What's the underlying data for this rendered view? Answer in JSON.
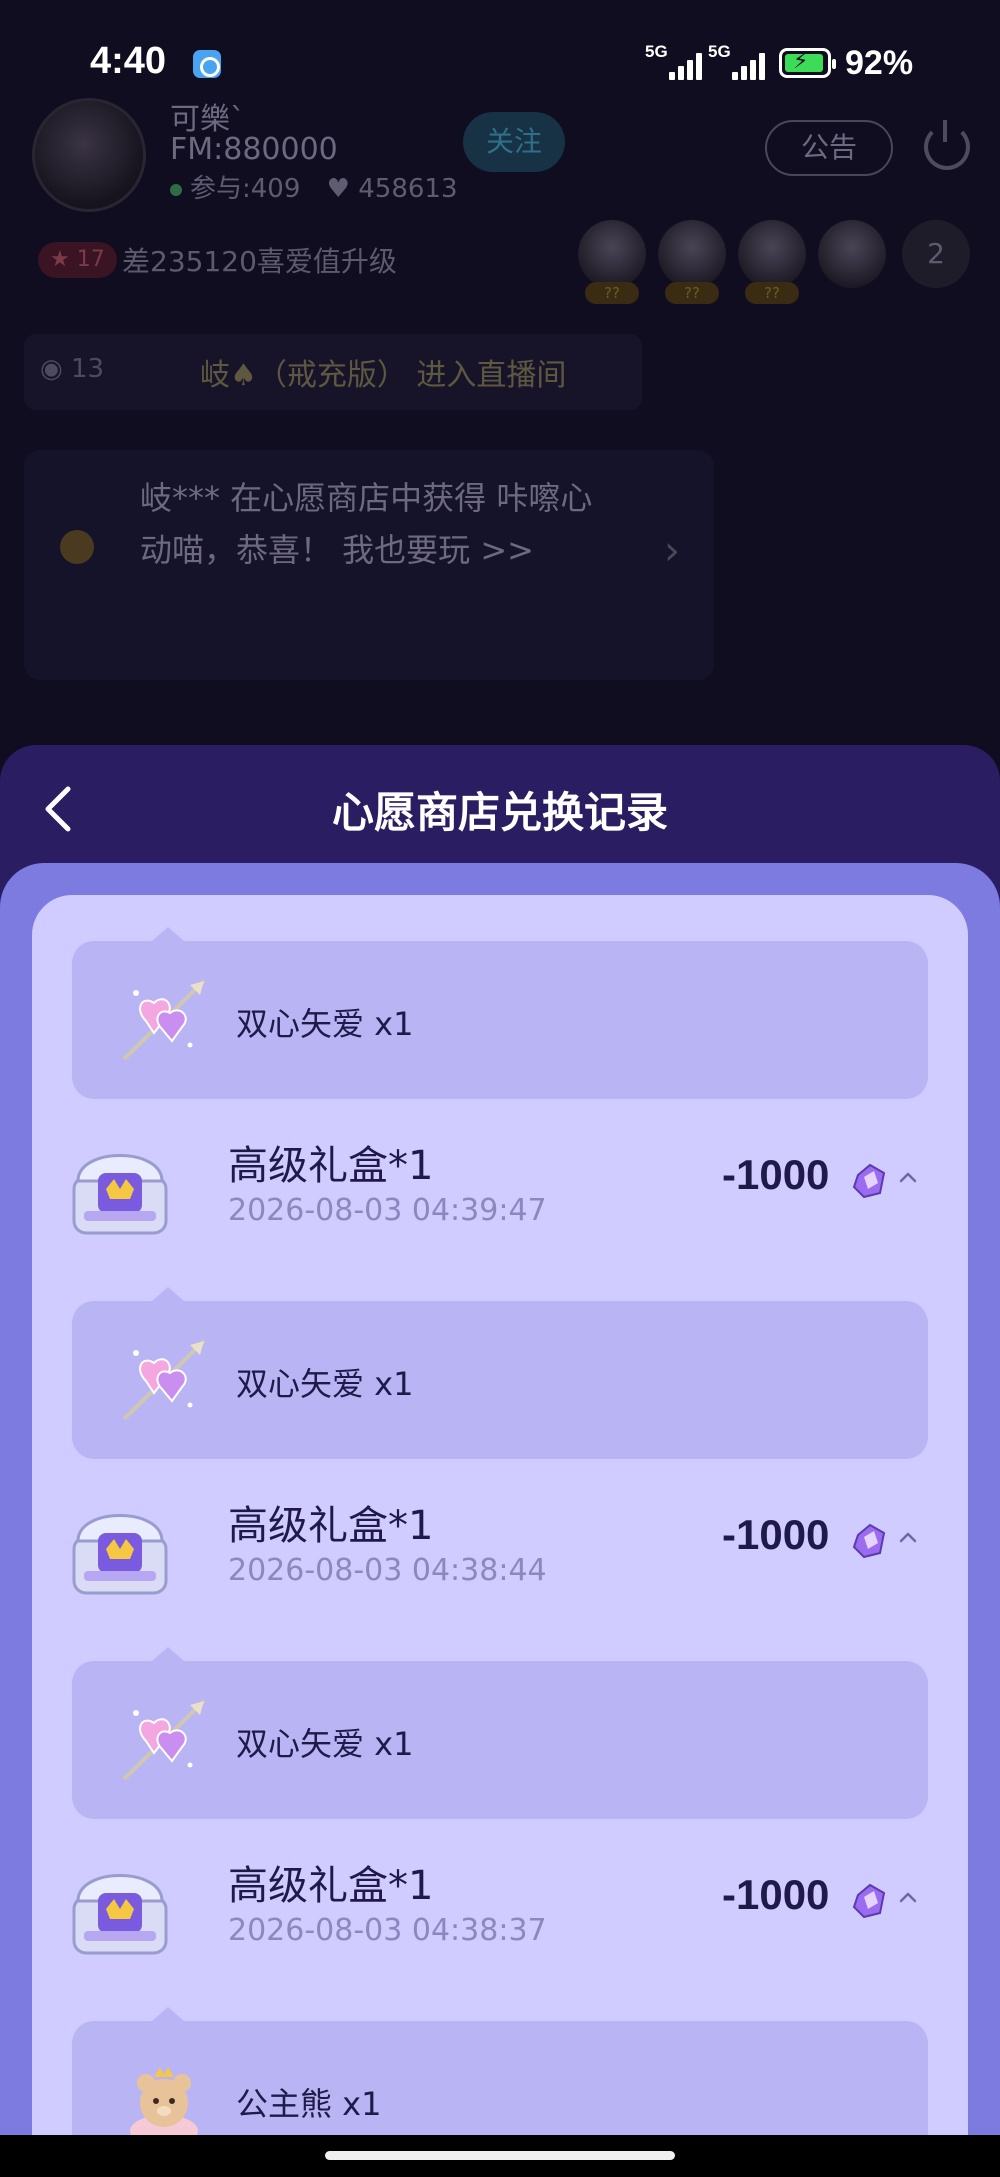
{
  "status_bar": {
    "time": "4:40",
    "network_1": "5G",
    "network_2": "5G",
    "battery_percent": "92%",
    "battery_level": 0.92,
    "charging": true
  },
  "room": {
    "host_name": "可樂`",
    "fm_id": "FM:880000",
    "participants": "参与:409",
    "hearts": "458613",
    "follow_label": "关注",
    "notice_label": "公告",
    "level_badge": "17",
    "upgrade_text": "差235120喜爱值升级",
    "viewer_tags": [
      "??",
      "??",
      "??"
    ],
    "viewer_count": "2",
    "enter_level": "13",
    "enter_text": "岐♠（戒充版） 进入直播间",
    "message_text": "岐*** 在心愿商店中获得 咔嚓心动喵，恭喜！ 我也要玩 >>"
  },
  "sheet": {
    "title": "心愿商店兑换记录",
    "records": [
      {
        "reward_label": "双心矢爱 x1",
        "reward_icon": "double-heart-arrow-icon",
        "name": "高级礼盒*1",
        "time": "2026-08-03 04:39:47",
        "amount": "-1000"
      },
      {
        "reward_label": "双心矢爱 x1",
        "reward_icon": "double-heart-arrow-icon",
        "name": "高级礼盒*1",
        "time": "2026-08-03 04:38:44",
        "amount": "-1000"
      },
      {
        "reward_label": "双心矢爱 x1",
        "reward_icon": "double-heart-arrow-icon",
        "name": "高级礼盒*1",
        "time": "2026-08-03 04:38:37",
        "amount": "-1000"
      }
    ],
    "last_reward": {
      "label": "公主熊 x1",
      "icon": "princess-bear-icon"
    }
  },
  "colors": {
    "sheet_bg": "#2a1d62",
    "panel_bg": "#7e7be0",
    "list_bg": "#d0ccff",
    "reward_bg": "#b9b5f4",
    "text_dark": "#1f1a4a",
    "time_text": "#8c88bf"
  }
}
